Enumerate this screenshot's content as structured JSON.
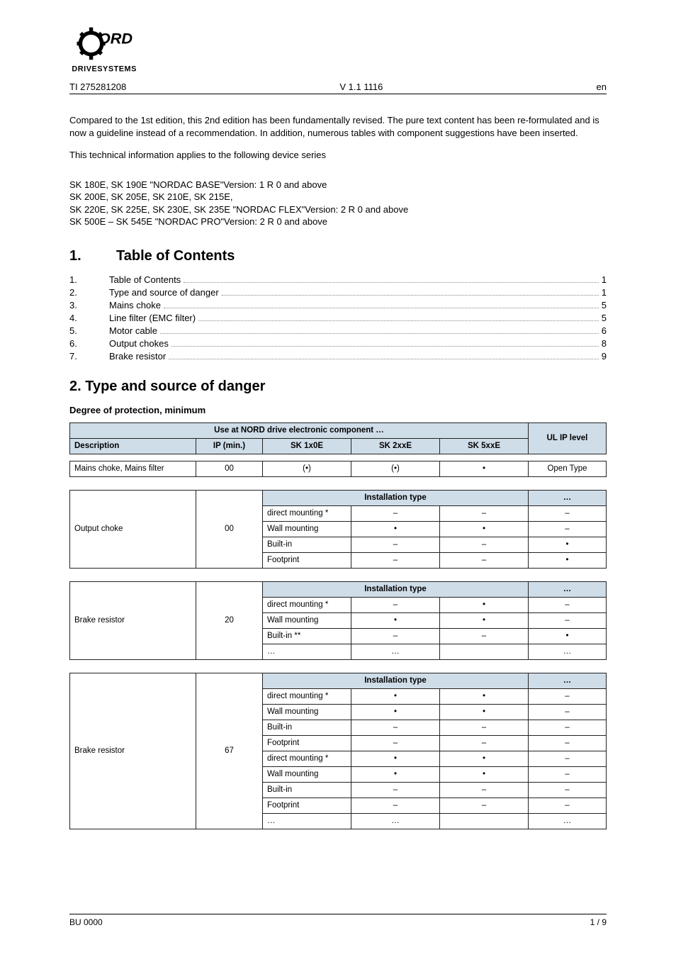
{
  "header": {
    "doc_id": "TI 275281208",
    "rev": "V 1.1 1116",
    "lang": "en"
  },
  "edition_note": "Compared to the 1st edition, this 2nd edition has been fundamentally revised. The pure text content has been re-formulated and is now a guideline instead of a recommendation. In addition, numerous tables with component suggestions have been inserted.",
  "applies_to": "This technical information applies to the following device series",
  "series1": "SK 180E, SK 190E \"NORDAC BASE\"Version: 1 R 0 and above",
  "series2": "SK 200E, SK 205E, SK 210E, SK 215E,",
  "series3": "SK 220E, SK 225E, SK 230E, SK 235E \"NORDAC FLEX\"Version: 2 R 0 and above",
  "series4": "SK 500E – SK 545E \"NORDAC PRO\"Version: 2 R 0 and above",
  "toc": {
    "heading_num": "1.",
    "heading_title": "Table of Contents",
    "items": [
      {
        "num": "1.",
        "label": "Table of Contents",
        "page": "1"
      },
      {
        "num": "2.",
        "label": "Type and source of danger",
        "page": "1"
      },
      {
        "num": "3.",
        "label": "Mains choke",
        "page": "5"
      },
      {
        "num": "4.",
        "label": "Line filter (EMC filter)",
        "page": "5"
      },
      {
        "num": "5.",
        "label": "Motor cable",
        "page": "6"
      },
      {
        "num": "6.",
        "label": "Output chokes",
        "page": "8"
      },
      {
        "num": "7.",
        "label": "Brake resistor",
        "page": "9"
      }
    ]
  },
  "main_heading": "2. Type and source of danger",
  "sub_heading": "Degree of protection, minimum",
  "table1": {
    "head_span": "Use at NORD drive electronic component …",
    "head_right": "UL IP level",
    "cols": [
      "Description",
      "IP (min.)",
      "SK 1x0E",
      "SK 2xxE",
      "SK 5xxE"
    ],
    "row": [
      "Mains choke, Mains filter",
      "00",
      "(•)",
      "(•)",
      "•",
      "Open Type"
    ]
  },
  "table2": {
    "rowhead": "Output choke",
    "ip": "00",
    "inner_head": "Installation type",
    "inner_right": "…",
    "rows": [
      [
        "direct mounting *",
        "–",
        "–",
        "–"
      ],
      [
        "Wall mounting",
        "•",
        "•",
        "–"
      ],
      [
        "Built-in",
        "–",
        "–",
        "•"
      ],
      [
        "Footprint",
        "–",
        "–",
        "•"
      ]
    ]
  },
  "table3": {
    "rowhead": "Brake resistor",
    "ip": "20",
    "inner_head": "Installation type",
    "inner_right": "…",
    "rows": [
      [
        "direct mounting *",
        "–",
        "•",
        "–"
      ],
      [
        "Wall mounting",
        "•",
        "•",
        "–"
      ],
      [
        "Built-in **",
        "–",
        "–",
        "•"
      ],
      [
        "…",
        "…",
        "",
        "…"
      ]
    ]
  },
  "table4": {
    "rowhead": "Brake resistor",
    "ip": "67",
    "inner_head": "Installation type",
    "inner_right": "…",
    "rows": [
      [
        "direct mounting *",
        "•",
        "•",
        "–"
      ],
      [
        "Wall mounting",
        "•",
        "•",
        "–"
      ],
      [
        "Built-in",
        "–",
        "–",
        "–"
      ],
      [
        "Footprint",
        "–",
        "–",
        "–"
      ],
      [
        "direct mounting *",
        "•",
        "•",
        "–"
      ],
      [
        "Wall mounting",
        "•",
        "•",
        "–"
      ],
      [
        "Built-in",
        "–",
        "–",
        "–"
      ],
      [
        "Footprint",
        "–",
        "–",
        "–"
      ],
      [
        "…",
        "…",
        "",
        "…"
      ]
    ]
  },
  "footer": {
    "left": "BU 0000",
    "right": "1 / 9"
  }
}
